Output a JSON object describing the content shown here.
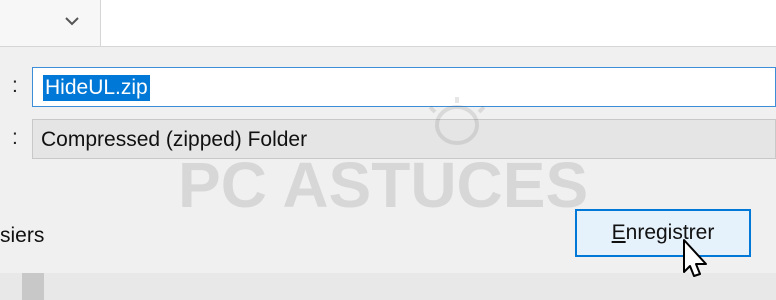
{
  "filename": {
    "label": ":",
    "value": "HideUL.zip"
  },
  "filetype": {
    "label": ":",
    "value": "Compressed (zipped) Folder"
  },
  "hide_folders_label": "siers",
  "save_button": {
    "accel": "E",
    "rest": "nregistrer"
  },
  "icons": {
    "chevron": "chevron-down-icon",
    "cursor": "mouse-pointer-icon",
    "watermark": "pc-astuces-logo"
  },
  "watermark_text": "PC ASTUCES",
  "colors": {
    "accent": "#0078d7",
    "selection": "#0078d7",
    "button_bg": "#e5f1fb"
  }
}
